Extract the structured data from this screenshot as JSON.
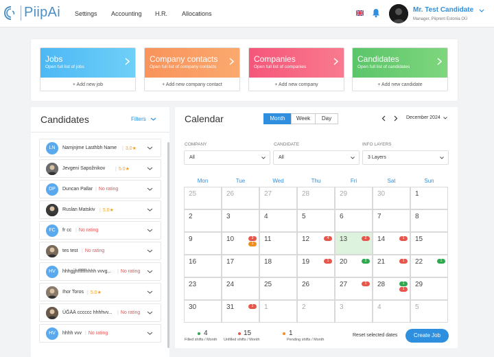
{
  "header": {
    "logo_text": "PiipAi",
    "nav": [
      "Settings",
      "Accounting",
      "H.R.",
      "Allocations"
    ],
    "user_name": "Mr. Test Candidate",
    "user_role": "Manager, Piiprent Estonia OÜ"
  },
  "quick_cards": [
    {
      "title": "Jobs",
      "subtitle": "Open full list of jobs",
      "action": "+ Add new job",
      "color_from": "#4db8f5",
      "color_to": "#6fd0f7"
    },
    {
      "title": "Company contacts",
      "subtitle": "Open full list of company contacts",
      "action": "+ Add new company contact",
      "color_from": "#f8935b",
      "color_to": "#fba96e"
    },
    {
      "title": "Companies",
      "subtitle": "Open full list of companies",
      "action": "+ Add new company",
      "color_from": "#f5567a",
      "color_to": "#f97a8e"
    },
    {
      "title": "Candidates",
      "subtitle": "Open full list of candidates",
      "action": "+ Add new candidate",
      "color_from": "#5bc56a",
      "color_to": "#7fd67d"
    }
  ],
  "candidates_panel": {
    "title": "Candidates",
    "filters_label": "Filters",
    "rows": [
      {
        "initials": "LN",
        "name": "Namjnjme Lasthbh Name",
        "rating": "3.0",
        "has_rating": true,
        "avatar_color": "#5aa9ee",
        "photo": false
      },
      {
        "initials": "",
        "name": "Jevgeni Sapožnikov",
        "rating": "5.0",
        "has_rating": true,
        "avatar_color": "#6b6b6b",
        "photo": true
      },
      {
        "initials": "DP",
        "name": "Duncan Pallar",
        "rating": "No rating",
        "has_rating": false,
        "avatar_color": "#5aa9ee",
        "photo": false
      },
      {
        "initials": "",
        "name": "Ruslan Matskiv",
        "rating": "5.0",
        "has_rating": true,
        "avatar_color": "#3a3a3a",
        "photo": true
      },
      {
        "initials": "FC",
        "name": "fr cc",
        "rating": "No rating",
        "has_rating": false,
        "avatar_color": "#5aa9ee",
        "photo": false
      },
      {
        "initials": "",
        "name": "tes test",
        "rating": "No rating",
        "has_rating": false,
        "avatar_color": "#7a6a5a",
        "photo": true
      },
      {
        "initials": "HV",
        "name": "hhhgjjhffffffhhhh vvvg...",
        "rating": "No rating",
        "has_rating": false,
        "avatar_color": "#5aa9ee",
        "photo": false
      },
      {
        "initials": "",
        "name": "Ihor Toros",
        "rating": "5.0",
        "has_rating": true,
        "avatar_color": "#8a7a6a",
        "photo": true
      },
      {
        "initials": "",
        "name": "ÜĞÄÄ cccccc hhhhvv...",
        "rating": "No rating",
        "has_rating": false,
        "avatar_color": "#6a5a4a",
        "photo": true
      },
      {
        "initials": "HV",
        "name": "hhhh vvv",
        "rating": "No rating",
        "has_rating": false,
        "avatar_color": "#5aa9ee",
        "photo": false
      }
    ]
  },
  "calendar": {
    "title": "Calendar",
    "views": [
      "Month",
      "Week",
      "Day"
    ],
    "active_view": "Month",
    "month_label": "December 2024",
    "filters": [
      {
        "label": "COMPANY",
        "value": "All"
      },
      {
        "label": "CANDIDATE",
        "value": "All"
      },
      {
        "label": "INFO LAYERS",
        "value": "3 Layers"
      }
    ],
    "weekdays": [
      "Mon",
      "Tue",
      "Wed",
      "Thu",
      "Fri",
      "Sat",
      "Sun"
    ],
    "days": [
      {
        "n": "25",
        "muted": true
      },
      {
        "n": "26",
        "muted": true
      },
      {
        "n": "27",
        "muted": true
      },
      {
        "n": "28",
        "muted": true
      },
      {
        "n": "29",
        "muted": true
      },
      {
        "n": "30",
        "muted": true
      },
      {
        "n": "1"
      },
      {
        "n": "2"
      },
      {
        "n": "3"
      },
      {
        "n": "4"
      },
      {
        "n": "5"
      },
      {
        "n": "6"
      },
      {
        "n": "7"
      },
      {
        "n": "8"
      },
      {
        "n": "9"
      },
      {
        "n": "10",
        "badges": [
          {
            "c": "red",
            "v": "3"
          },
          {
            "c": "orange",
            "v": "1"
          }
        ]
      },
      {
        "n": "11"
      },
      {
        "n": "12",
        "badges": [
          {
            "c": "red",
            "v": "4"
          }
        ]
      },
      {
        "n": "13",
        "today": true,
        "badges": [
          {
            "c": "red",
            "v": "2"
          }
        ]
      },
      {
        "n": "14",
        "badges": [
          {
            "c": "red",
            "v": "1"
          }
        ]
      },
      {
        "n": "15"
      },
      {
        "n": "16"
      },
      {
        "n": "17"
      },
      {
        "n": "18"
      },
      {
        "n": "19",
        "badges": [
          {
            "c": "red",
            "v": "1"
          }
        ]
      },
      {
        "n": "20",
        "badges": [
          {
            "c": "green",
            "v": "2"
          }
        ]
      },
      {
        "n": "21",
        "badges": [
          {
            "c": "red",
            "v": "1"
          }
        ]
      },
      {
        "n": "22",
        "badges": [
          {
            "c": "green",
            "v": "1"
          }
        ]
      },
      {
        "n": "23"
      },
      {
        "n": "24"
      },
      {
        "n": "25"
      },
      {
        "n": "26"
      },
      {
        "n": "27",
        "badges": [
          {
            "c": "red",
            "v": "1"
          }
        ]
      },
      {
        "n": "28",
        "badges": [
          {
            "c": "green",
            "v": "1"
          },
          {
            "c": "red",
            "v": "1"
          }
        ]
      },
      {
        "n": "29"
      },
      {
        "n": "30"
      },
      {
        "n": "31",
        "badges": [
          {
            "c": "red",
            "v": "1"
          }
        ]
      },
      {
        "n": "1",
        "muted": true
      },
      {
        "n": "2",
        "muted": true
      },
      {
        "n": "3",
        "muted": true
      },
      {
        "n": "4",
        "muted": true
      },
      {
        "n": "5",
        "muted": true
      }
    ],
    "stats": [
      {
        "value": "4",
        "label": "Filled shifts / Month",
        "color": "#2fa84f"
      },
      {
        "value": "15",
        "label": "Unfilled shifts / Month",
        "color": "#e7564a"
      },
      {
        "value": "1",
        "label": "Pending shifts / Month",
        "color": "#f08e22"
      }
    ],
    "reset_label": "Reset selected dates",
    "create_label": "Create Job"
  }
}
